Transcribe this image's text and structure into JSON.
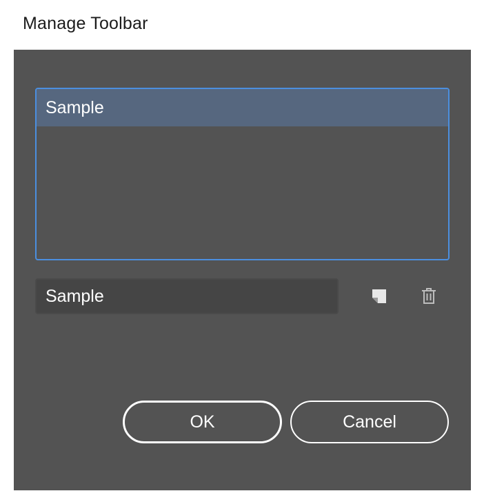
{
  "window": {
    "title": "Manage Toolbar"
  },
  "list": {
    "items": [
      {
        "label": "Sample",
        "selected": true
      }
    ]
  },
  "name_field": {
    "value": "Sample"
  },
  "actions": {
    "new_icon": "new-toolbar-icon",
    "delete_icon": "trash-icon"
  },
  "buttons": {
    "ok_label": "OK",
    "cancel_label": "Cancel"
  },
  "colors": {
    "dialog_bg": "#535353",
    "selection": "#56677f",
    "focus_border": "#4b8fe0"
  }
}
